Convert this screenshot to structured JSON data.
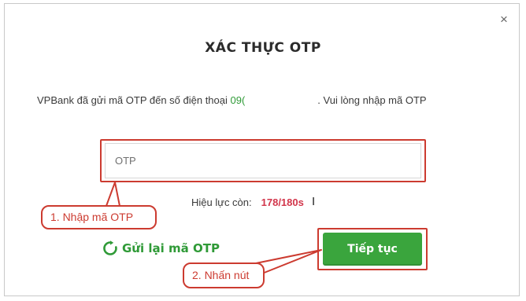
{
  "dialog": {
    "close_symbol": "×",
    "title": "XÁC THỰC OTP",
    "message_prefix": "VPBank đã gửi mã OTP đến số điện thoại ",
    "phone_partial": "09(",
    "message_suffix": ". Vui lòng nhập mã OTP",
    "otp_input": {
      "placeholder": "OTP",
      "value": ""
    },
    "validity_label": "Hiệu lực còn:",
    "countdown": "178/180s",
    "resend": {
      "icon": "refresh-icon",
      "label": "Gửi lại mã OTP"
    },
    "continue_label": "Tiếp tục"
  },
  "annotations": {
    "step1": "1. Nhập mã OTP",
    "step2": "2. Nhấn nút"
  },
  "colors": {
    "accent_green": "#3aa53d",
    "annotation_red": "#cc3b30",
    "countdown_red": "#d2364b"
  }
}
